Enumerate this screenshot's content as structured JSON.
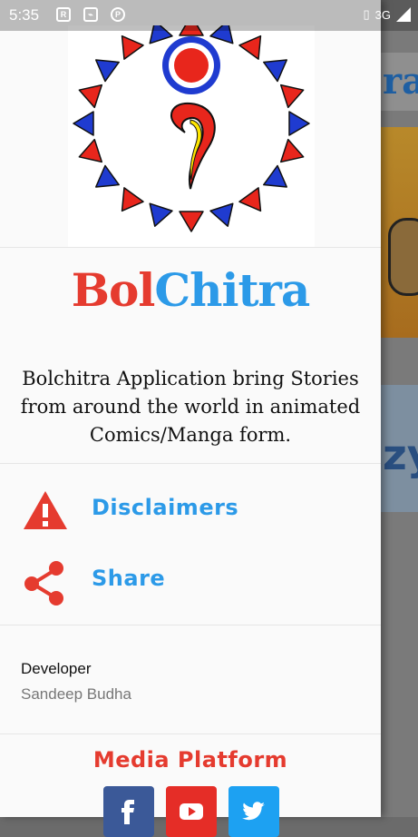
{
  "status_bar": {
    "time": "5:35",
    "network": "3G",
    "icons": [
      "rr-icon",
      "usb-icon",
      "p-icon"
    ]
  },
  "background_app": {
    "title_fragment": "ra",
    "card_text": "zy"
  },
  "drawer": {
    "brand": {
      "part1": "Bol",
      "part2": "Chitra"
    },
    "description": "Bolchitra Application bring Stories from around the world in animated Comics/Manga form.",
    "menu": [
      {
        "label": "Disclaimers",
        "icon": "warning-icon"
      },
      {
        "label": "Share",
        "icon": "share-icon"
      }
    ],
    "developer": {
      "title": "Developer",
      "name": "Sandeep Budha"
    },
    "media_title": "Media Platform",
    "social": [
      {
        "name": "facebook",
        "color": "#3b5998"
      },
      {
        "name": "youtube",
        "color": "#e52d27"
      },
      {
        "name": "twitter",
        "color": "#1da1f2"
      }
    ]
  },
  "colors": {
    "accent_red": "#e53b2f",
    "accent_blue": "#2c9ae8"
  }
}
